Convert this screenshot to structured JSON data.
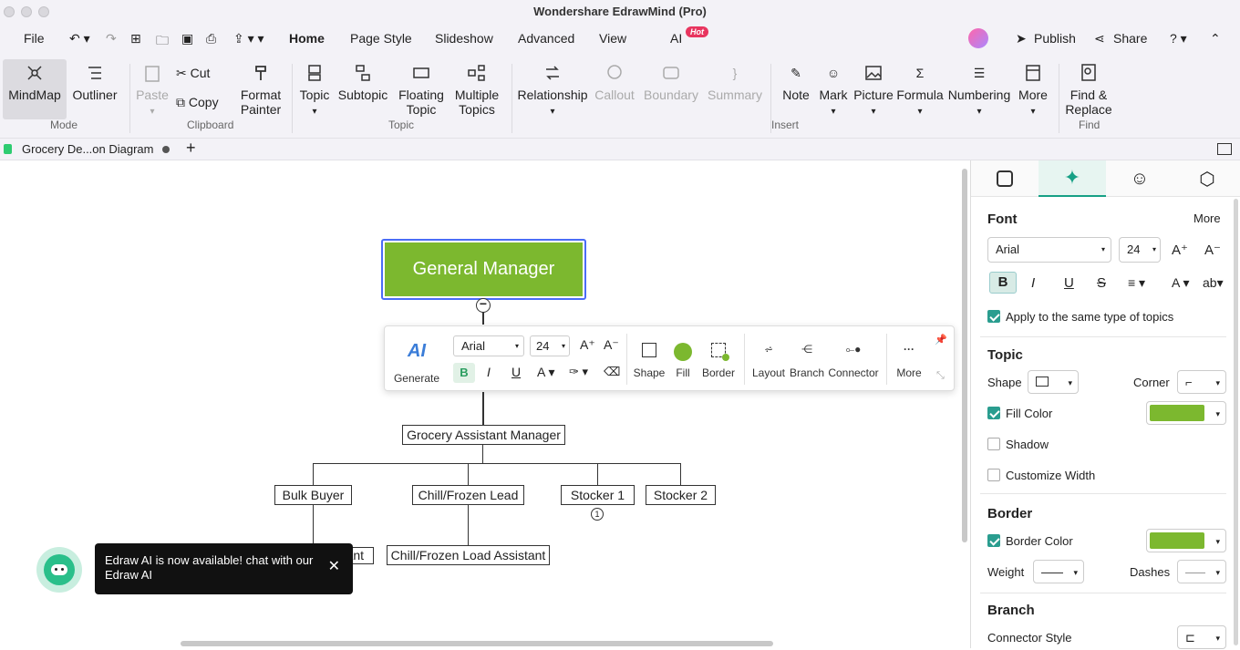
{
  "window": {
    "title": "Wondershare EdrawMind (Pro)"
  },
  "menu": {
    "file": "File",
    "home": "Home",
    "page_style": "Page Style",
    "slideshow": "Slideshow",
    "advanced": "Advanced",
    "view": "View",
    "ai": "AI",
    "ai_badge": "Hot",
    "publish": "Publish",
    "share": "Share"
  },
  "ribbon": {
    "mindmap": "MindMap",
    "outliner": "Outliner",
    "mode_group": "Mode",
    "paste": "Paste",
    "cut": "Cut",
    "copy": "Copy",
    "format_painter_1": "Format",
    "format_painter_2": "Painter",
    "clipboard_group": "Clipboard",
    "topic": "Topic",
    "subtopic": "Subtopic",
    "floating_1": "Floating",
    "floating_2": "Topic",
    "multiple_1": "Multiple",
    "multiple_2": "Topics",
    "topic_group": "Topic",
    "relationship": "Relationship",
    "callout": "Callout",
    "boundary": "Boundary",
    "summary": "Summary",
    "note": "Note",
    "mark": "Mark",
    "picture": "Picture",
    "formula": "Formula",
    "numbering": "Numbering",
    "more": "More",
    "insert_group": "Insert",
    "find_1": "Find &",
    "find_2": "Replace",
    "find_group": "Find"
  },
  "tab": {
    "name": "Grocery De...on Diagram"
  },
  "diagram": {
    "root": "General Manager",
    "assistant_manager": "Grocery Assistant Manager",
    "bulk_buyer": "Bulk Buyer",
    "chill_lead": "Chill/Frozen Lead",
    "stocker1": "Stocker 1",
    "stocker2": "Stocker 2",
    "bulk_assistant_partial": "ant",
    "chill_assistant": "Chill/Frozen Load Assistant",
    "stocker1_badge": "1"
  },
  "floating_toolbar": {
    "generate": "Generate",
    "ai": "AI",
    "font": "Arial",
    "size": "24",
    "shape": "Shape",
    "fill": "Fill",
    "border": "Border",
    "layout": "Layout",
    "branch": "Branch",
    "connector": "Connector",
    "more": "More"
  },
  "panel": {
    "font_title": "Font",
    "more": "More",
    "font_name": "Arial",
    "font_size": "24",
    "apply_same": "Apply to the same type of topics",
    "topic_title": "Topic",
    "shape": "Shape",
    "corner": "Corner",
    "fill_color": "Fill Color",
    "shadow": "Shadow",
    "customize_width": "Customize Width",
    "border_title": "Border",
    "border_color": "Border Color",
    "weight": "Weight",
    "dashes": "Dashes",
    "branch_title": "Branch",
    "connector_style": "Connector Style"
  },
  "toast": {
    "message": "Edraw AI is now available!  chat with our Edraw AI"
  },
  "colors": {
    "accent": "#7cb82f",
    "teal": "#16a085",
    "selection": "#4a6cf7"
  }
}
